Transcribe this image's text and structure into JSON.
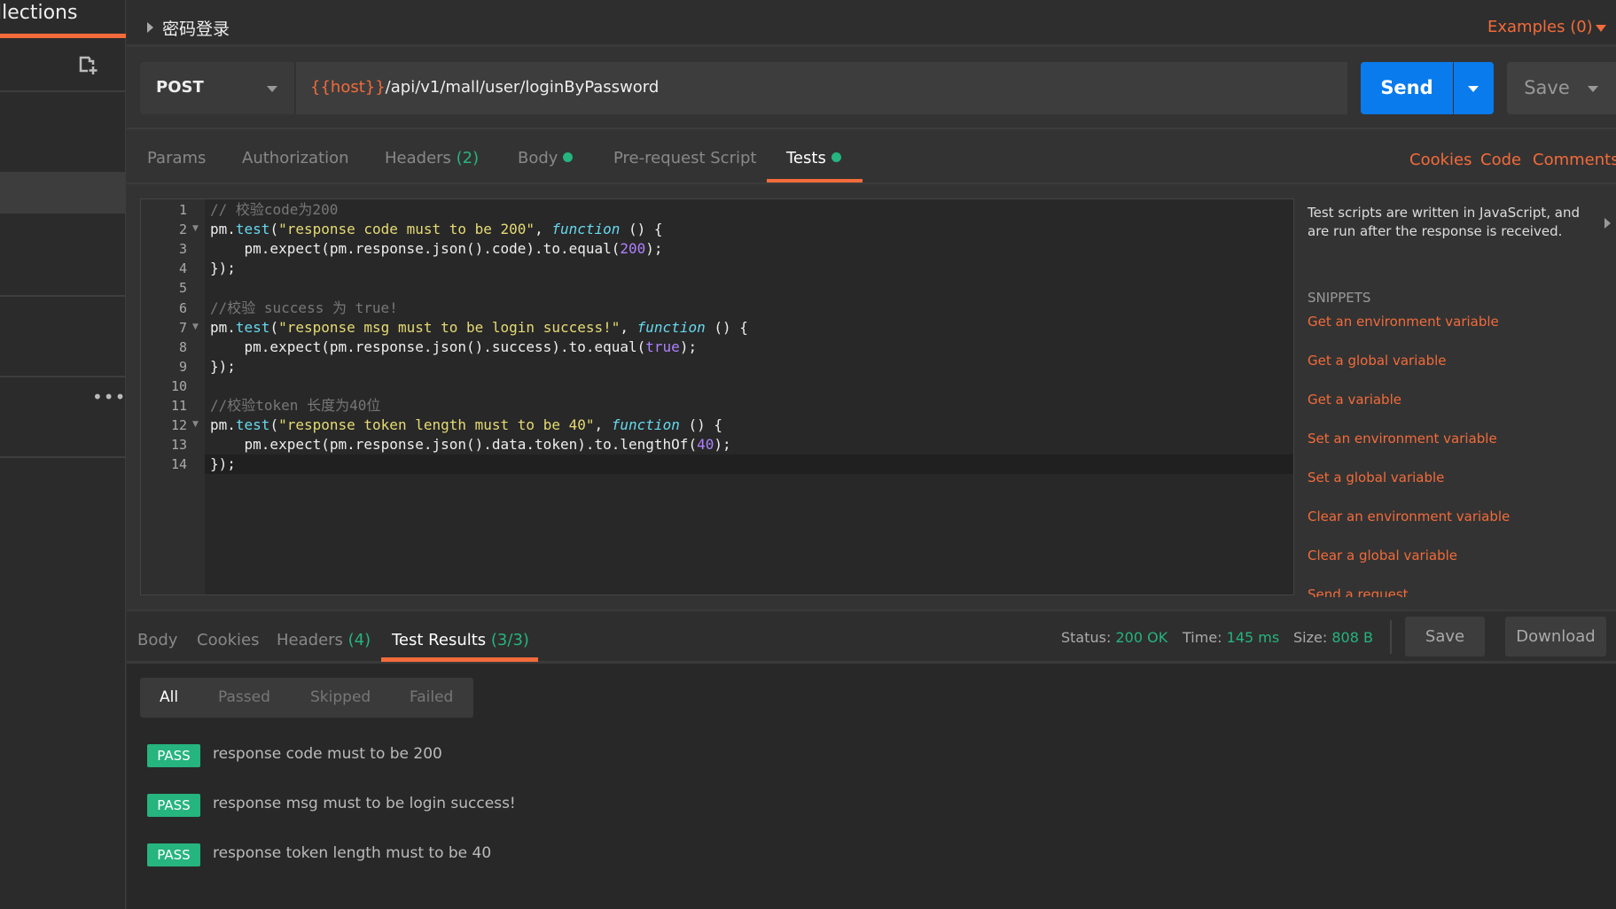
{
  "sidebar": {
    "title": "llections"
  },
  "request": {
    "name": "密码登录",
    "examples": "Examples (0)",
    "method": "POST",
    "url_var": "{{host}}",
    "url_path": "/api/v1/mall/user/loginByPassword",
    "send": "Send",
    "save": "Save"
  },
  "tabs": {
    "params": "Params",
    "authorization": "Authorization",
    "headers": "Headers",
    "headers_count": "(2)",
    "body": "Body",
    "prerequest": "Pre-request Script",
    "tests": "Tests",
    "cookies": "Cookies",
    "code": "Code",
    "comments": "Comments"
  },
  "editor": {
    "lines": [
      [
        [
          "cm",
          "// 校验code为200"
        ]
      ],
      [
        [
          "pl",
          "pm."
        ],
        [
          "fn",
          "test"
        ],
        [
          "pl",
          "("
        ],
        [
          "str",
          "\"response code must to be 200\""
        ],
        [
          "pl",
          ", "
        ],
        [
          "kw",
          "function"
        ],
        [
          "pl",
          " () {"
        ]
      ],
      [
        [
          "pl",
          "    pm.expect(pm.response.json().code).to.equal("
        ],
        [
          "num",
          "200"
        ],
        [
          "pl",
          ");"
        ]
      ],
      [
        [
          "pl",
          "});"
        ]
      ],
      [],
      [
        [
          "cm",
          "//校验 success 为 true!"
        ]
      ],
      [
        [
          "pl",
          "pm."
        ],
        [
          "fn",
          "test"
        ],
        [
          "pl",
          "("
        ],
        [
          "str",
          "\"response msg must to be login success!\""
        ],
        [
          "pl",
          ", "
        ],
        [
          "kw",
          "function"
        ],
        [
          "pl",
          " () {"
        ]
      ],
      [
        [
          "pl",
          "    pm.expect(pm.response.json().success).to.equal("
        ],
        [
          "num",
          "true"
        ],
        [
          "pl",
          ");"
        ]
      ],
      [
        [
          "pl",
          "});"
        ]
      ],
      [],
      [
        [
          "cm",
          "//校验token 长度为40位"
        ]
      ],
      [
        [
          "pl",
          "pm."
        ],
        [
          "fn",
          "test"
        ],
        [
          "pl",
          "("
        ],
        [
          "str",
          "\"response token length must to be 40\""
        ],
        [
          "pl",
          ", "
        ],
        [
          "kw",
          "function"
        ],
        [
          "pl",
          " () {"
        ]
      ],
      [
        [
          "pl",
          "    pm.expect(pm.response.json().data.token).to.lengthOf("
        ],
        [
          "num",
          "40"
        ],
        [
          "pl",
          ");"
        ]
      ],
      [
        [
          "pl",
          "});"
        ]
      ]
    ],
    "fold_lines": [
      2,
      7,
      12
    ],
    "current_line": 14
  },
  "help": {
    "text": "Test scripts are written in JavaScript, and are run after the response is received.",
    "snippets_title": "SNIPPETS",
    "snippets": [
      "Get an environment variable",
      "Get a global variable",
      "Get a variable",
      "Set an environment variable",
      "Set a global variable",
      "Clear an environment variable",
      "Clear a global variable",
      "Send a request"
    ]
  },
  "response": {
    "tabs": {
      "body": "Body",
      "cookies": "Cookies",
      "headers": "Headers",
      "headers_count": "(4)",
      "test_results": "Test Results",
      "test_count": "(3/3)"
    },
    "status_label": "Status:",
    "status": "200 OK",
    "time_label": "Time:",
    "time": "145 ms",
    "size_label": "Size:",
    "size": "808 B",
    "save": "Save",
    "download": "Download",
    "filters": [
      "All",
      "Passed",
      "Skipped",
      "Failed"
    ],
    "results": [
      {
        "badge": "PASS",
        "name": "response code must to be 200"
      },
      {
        "badge": "PASS",
        "name": "response msg must to be login success!"
      },
      {
        "badge": "PASS",
        "name": "response token length must to be 40"
      }
    ]
  },
  "colors": {
    "accent": "#f26b3a",
    "send": "#097bed",
    "pass": "#26b47f"
  }
}
